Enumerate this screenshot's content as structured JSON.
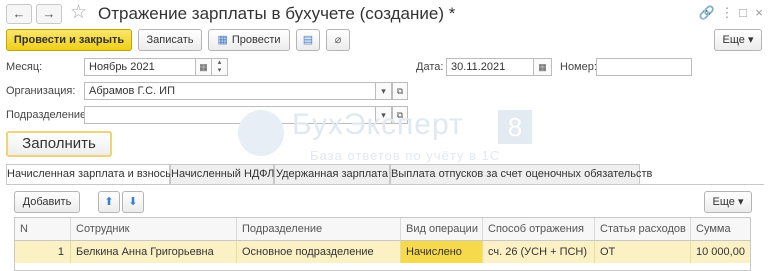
{
  "window": {
    "title": "Отражение зарплаты в бухучете (создание) *",
    "back_glyph": "←",
    "forward_glyph": "→",
    "star_glyph": "☆"
  },
  "titlebar_icons": {
    "link": "🔗",
    "more": "⋮",
    "maximize": "□",
    "close": "×"
  },
  "toolbar": {
    "post_close_label": "Провести и закрыть",
    "save_label": "Записать",
    "post_label": "Провести",
    "more_label": "Еще",
    "dropdown_glyph": "▾"
  },
  "form": {
    "month_label": "Месяц:",
    "month_value": "Ноябрь 2021",
    "date_label": "Дата:",
    "date_value": "30.11.2021",
    "number_label": "Номер:",
    "number_value": "",
    "org_label": "Организация:",
    "org_value": "Абрамов Г.С. ИП",
    "dept_label": "Подразделение:",
    "dept_value": "",
    "fill_label": "Заполнить"
  },
  "watermark": {
    "brand": "БухЭксперт",
    "brand_num": "8",
    "tagline": "База ответов по учёту в 1С"
  },
  "tabs": [
    {
      "label": "Начисленная зарплата и взносы",
      "active": true
    },
    {
      "label": "Начисленный НДФЛ",
      "active": false
    },
    {
      "label": "Удержанная зарплата",
      "active": false
    },
    {
      "label": "Выплата отпусков за счет оценочных обязательств",
      "active": false
    }
  ],
  "table_toolbar": {
    "add_label": "Добавить",
    "up_glyph": "⬆",
    "down_glyph": "⬇",
    "more_label": "Еще"
  },
  "table": {
    "columns": [
      "N",
      "Сотрудник",
      "Подразделение",
      "Вид операции",
      "Способ отражения",
      "Статья расходов",
      "Сумма"
    ],
    "rows": [
      [
        "1",
        "Белкина Анна Григорьевна",
        "Основное подразделение",
        "Начислено",
        "сч. 26 (УСН + ПСН)",
        "ОТ",
        "10 000,00"
      ]
    ]
  },
  "colors": {
    "accent": "#f0cf1a",
    "selected_row": "#fcf1c4",
    "active_cell": "#f7d94c"
  }
}
